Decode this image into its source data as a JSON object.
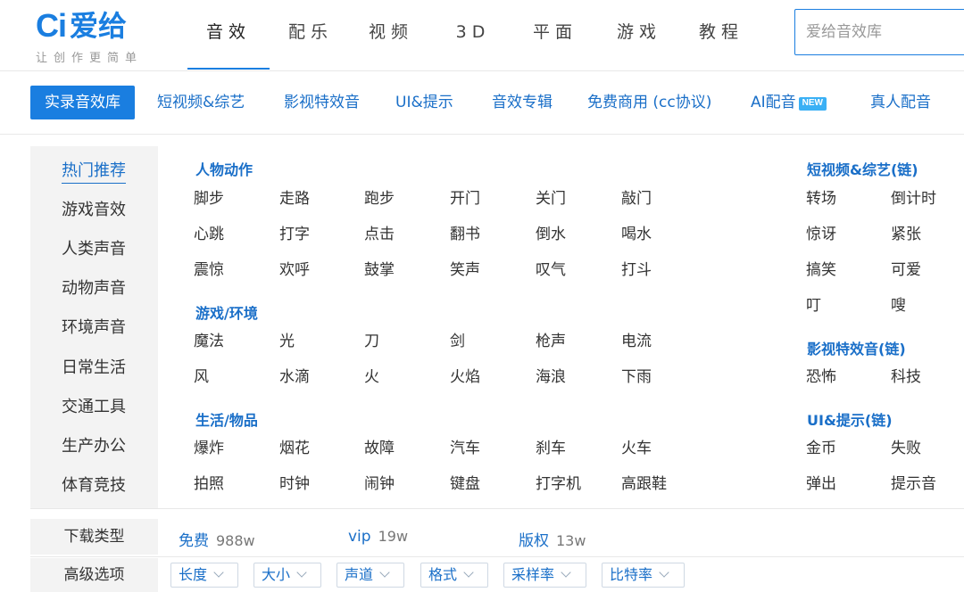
{
  "logo": {
    "mark": "Ci",
    "name": "爱给",
    "slogan": "让创作更简单"
  },
  "main_nav": [
    {
      "label": "音效",
      "active": true
    },
    {
      "label": "配乐"
    },
    {
      "label": "视频"
    },
    {
      "label": "3D"
    },
    {
      "label": "平面"
    },
    {
      "label": "游戏"
    },
    {
      "label": "教程"
    }
  ],
  "search": {
    "placeholder": "爱给音效库",
    "value": ""
  },
  "category_bar": {
    "items": [
      {
        "label": "实录音效库",
        "active": true
      },
      {
        "label": "短视频&综艺"
      },
      {
        "label": "影视特效音"
      },
      {
        "label": "UI&提示"
      },
      {
        "label": "音效专辑"
      },
      {
        "label": "免费商用 (cc协议)"
      },
      {
        "label": "AI配音",
        "badge": "NEW"
      },
      {
        "label": "真人配音"
      }
    ]
  },
  "sidebar": {
    "items": [
      {
        "label": "热门推荐",
        "active": true
      },
      {
        "label": "游戏音效"
      },
      {
        "label": "人类声音"
      },
      {
        "label": "动物声音"
      },
      {
        "label": "环境声音"
      },
      {
        "label": "日常生活"
      },
      {
        "label": "交通工具"
      },
      {
        "label": "生产办公"
      },
      {
        "label": "体育竞技"
      }
    ]
  },
  "groups": {
    "people": {
      "title": "人物动作",
      "tags": [
        "脚步",
        "走路",
        "跑步",
        "开门",
        "关门",
        "敲门",
        "心跳",
        "打字",
        "点击",
        "翻书",
        "倒水",
        "喝水",
        "震惊",
        "欢呼",
        "鼓掌",
        "笑声",
        "叹气",
        "打斗"
      ]
    },
    "game": {
      "title": "游戏/环境",
      "tags": [
        "魔法",
        "光",
        "刀",
        "剑",
        "枪声",
        "电流",
        "风",
        "水滴",
        "火",
        "火焰",
        "海浪",
        "下雨"
      ]
    },
    "life": {
      "title": "生活/物品",
      "tags": [
        "爆炸",
        "烟花",
        "故障",
        "汽车",
        "刹车",
        "火车",
        "拍照",
        "时钟",
        "闹钟",
        "键盘",
        "打字机",
        "高跟鞋"
      ]
    },
    "short_video": {
      "title": "短视频&综艺(链)",
      "tags": [
        "转场",
        "倒计时",
        "惊讶",
        "紧张",
        "搞笑",
        "可爱",
        "叮",
        "嗖"
      ]
    },
    "film": {
      "title": "影视特效音(链)",
      "tags": [
        "恐怖",
        "科技"
      ]
    },
    "ui": {
      "title": "UI&提示(链)",
      "tags": [
        "金币",
        "失败",
        "弹出",
        "提示音"
      ]
    }
  },
  "filters": {
    "download_type": {
      "label": "下载类型",
      "options": [
        {
          "label": "免费",
          "count": "988w"
        },
        {
          "label": "vip",
          "count": "19w"
        },
        {
          "label": "版权",
          "count": "13w"
        }
      ]
    },
    "advanced": {
      "label": "高级选项",
      "dropdowns": [
        "长度",
        "大小",
        "声道",
        "格式",
        "采样率",
        "比特率"
      ]
    }
  },
  "colors": {
    "accent": "#1a7ee0",
    "link": "#1a6fc8",
    "sidebar_bg": "#f3f3f3"
  }
}
